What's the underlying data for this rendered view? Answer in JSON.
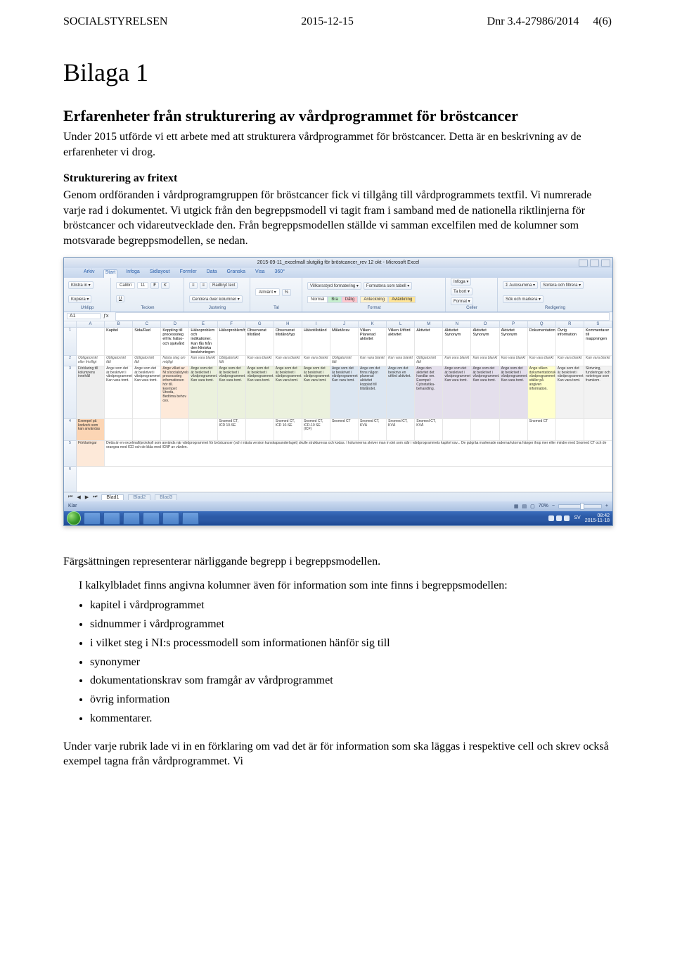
{
  "header": {
    "left": "SOCIALSTYRELSEN",
    "center": "2015-12-15",
    "right_dnr": "Dnr 3.4-27986/2014",
    "right_page": "4(6)"
  },
  "h1": "Bilaga 1",
  "h2": "Erfarenheter från strukturering av vårdprogrammet för bröstcancer",
  "p1": "Under 2015 utförde vi ett arbete med att strukturera vårdprogrammet för bröstcancer. Detta är en beskrivning av de erfarenheter vi drog.",
  "section1_title": "Strukturering av fritext",
  "p2": "Genom ordföranden i vårdprogramgruppen för bröstcancer fick vi tillgång till vårdprogrammets textfil. Vi numrerade varje rad i dokumentet. Vi utgick från den begreppsmodell vi tagit fram i samband med de nationella riktlinjerna för bröstcancer och vidareutvecklade den. Från begreppsmodellen ställde vi samman excelfilen med de kolumner som motsvarade begreppsmodellen, se nedan.",
  "excel": {
    "title": "2015-09-11_excelmall slutgilig för bröstcancer_rev 12 okt - Microsoft Excel",
    "ribbon_tabs": [
      "Arkiv",
      "Start",
      "Infoga",
      "Sidlayout",
      "Formler",
      "Data",
      "Granska",
      "Visa",
      "360°"
    ],
    "ribbon_groups": [
      "Urklipp",
      "Tecken",
      "Justering",
      "Tal",
      "Format",
      "Celler",
      "Redigering"
    ],
    "font_name": "Calibri",
    "font_size": "11",
    "styles": {
      "normal": "Normal",
      "bra": "Bra",
      "dalig": "Dålig",
      "anteckning": "Anteckning",
      "avlank": "Avlänkning"
    },
    "namebox": "A1",
    "cols": [
      "A",
      "B",
      "C",
      "D",
      "E",
      "F",
      "G",
      "H",
      "I",
      "J",
      "K",
      "L",
      "M",
      "N",
      "O",
      "P",
      "Q",
      "R",
      "S"
    ],
    "row1": {
      "A": "",
      "B": "Kapitel",
      "C": "Sida/Rad",
      "D": "Koppling till processsteg ell liv. hälso- och sjukvård",
      "E": "Hälsoproblem och \nindikationer. Kan fås från den kliniska beskrivningen",
      "F": "Hälsoproblem/typ",
      "G": "Observerat tillstånd",
      "H": "Observerat tillstånd/typ",
      "I": "Hälsotillstånd",
      "J": "Målet/krav",
      "K": "Vilken Planerad aktivitet",
      "L": "Vilken Utförd aktivitet",
      "M": "Aktivitet",
      "N": "Aktivitet Synonym",
      "O": "Aktivitet Synonym",
      "P": "Aktivitet Synonym",
      "Q": "Dokumentationskrav",
      "R": "Övrig information",
      "S": "Kommentarer till mappningen"
    },
    "row_oblig_label": "Obligatoriskt eller frivilligt",
    "row_oblig": [
      "",
      "Obligatoriskt fält",
      "Obligatoriskt fält",
      "Nästa steg om möjligt",
      "Kan vara blankt",
      "Obligatoriskt fält",
      "Kan vara blankt",
      "Kan vara blankt",
      "Kan vara blankt",
      "Obligatoriskt fält",
      "Kan vara blankt",
      "Kan vara blankt",
      "Obligatoriskt fält",
      "Kan vara blankt",
      "Kan vara blankt",
      "Kan vara blankt",
      "Kan vara blankt",
      "Kan vara blankt",
      "Kan vara blankt"
    ],
    "row_desc_label": "Förklaring till kolumnens innehåll",
    "row_desc_D": "Ange vilket av NI:s/socialstyrelsens processsteg informationen hör till. Exempel: Utreda, Bedöma behov osv.",
    "row_desc_generic": "Ange som det är beskrivet i vårdprogrammet. Kan vara tomt.",
    "row_desc_K": "Ange om det finns någon planerad aktivitet kopplad till tillståndet.",
    "row_desc_L": "Ange om det beskrivs en utförd aktivitet.",
    "row_desc_M": "Ange den aktivitet det handlar om. Exempel: Cytostatika-behandling.",
    "row_desc_Q": "Ange vilken dokumentationskrav vårdprogrammet ställer på angiven information.",
    "row_desc_S": "Skrivning, funderingar och noteringar som framkom.",
    "row_exempel_label": "Exempel på kodverk som kan användas",
    "row_exempel": {
      "F": "Snomed CT, ICD 10-SE",
      "H": "Snomed CT, ICD 10-SE",
      "I": "Snomed CT, ICD-10 SE (ICF)",
      "J": "Snomed CT",
      "K": "Snomed CT, KVÅ",
      "L": "Snomed CT, KVÅ",
      "M": "Snomed CT, KVÅ",
      "Q": "Snomed CT"
    },
    "row_fork_label": "Förklaringar",
    "row_fork_text": "Detta är en excelmall/protokoll som används när vårdprogrammet för bröstcancer (och i nästa version kunskapsunderlaget) skulle struktureras och kodas. I kolumnerna skriver man in det som står i vårdprogrammets kapitel osv... De gulgråa markerade raderna/rutorna hänger ihop mer eller mindre med Snomed CT och de orangea med ICD och de blåa med ICNP av vården.",
    "sheet_tabs": [
      "Blad1",
      "Blad2",
      "Blad3"
    ],
    "status_left": "Klar",
    "zoom": "70%",
    "clock": "08:42\n2015-11-18",
    "lang": "SV"
  },
  "p3": "Färgsättningen representerar närliggande begrepp i begreppsmodellen.",
  "p4": "I kalkylbladet finns angivna kolumner även för information som inte finns i begreppsmodellen:",
  "bullets": [
    "kapitel i vårdprogrammet",
    "sidnummer i vårdprogrammet",
    "i vilket steg i NI:s processmodell som informationen hänför sig till",
    "synonymer",
    "dokumentationskrav som framgår av vårdprogrammet",
    "övrig information",
    "kommentarer."
  ],
  "p5": "Under varje rubrik lade vi in en förklaring om vad det är för information som ska läggas i respektive cell och skrev också exempel tagna från vårdprogrammet. Vi"
}
